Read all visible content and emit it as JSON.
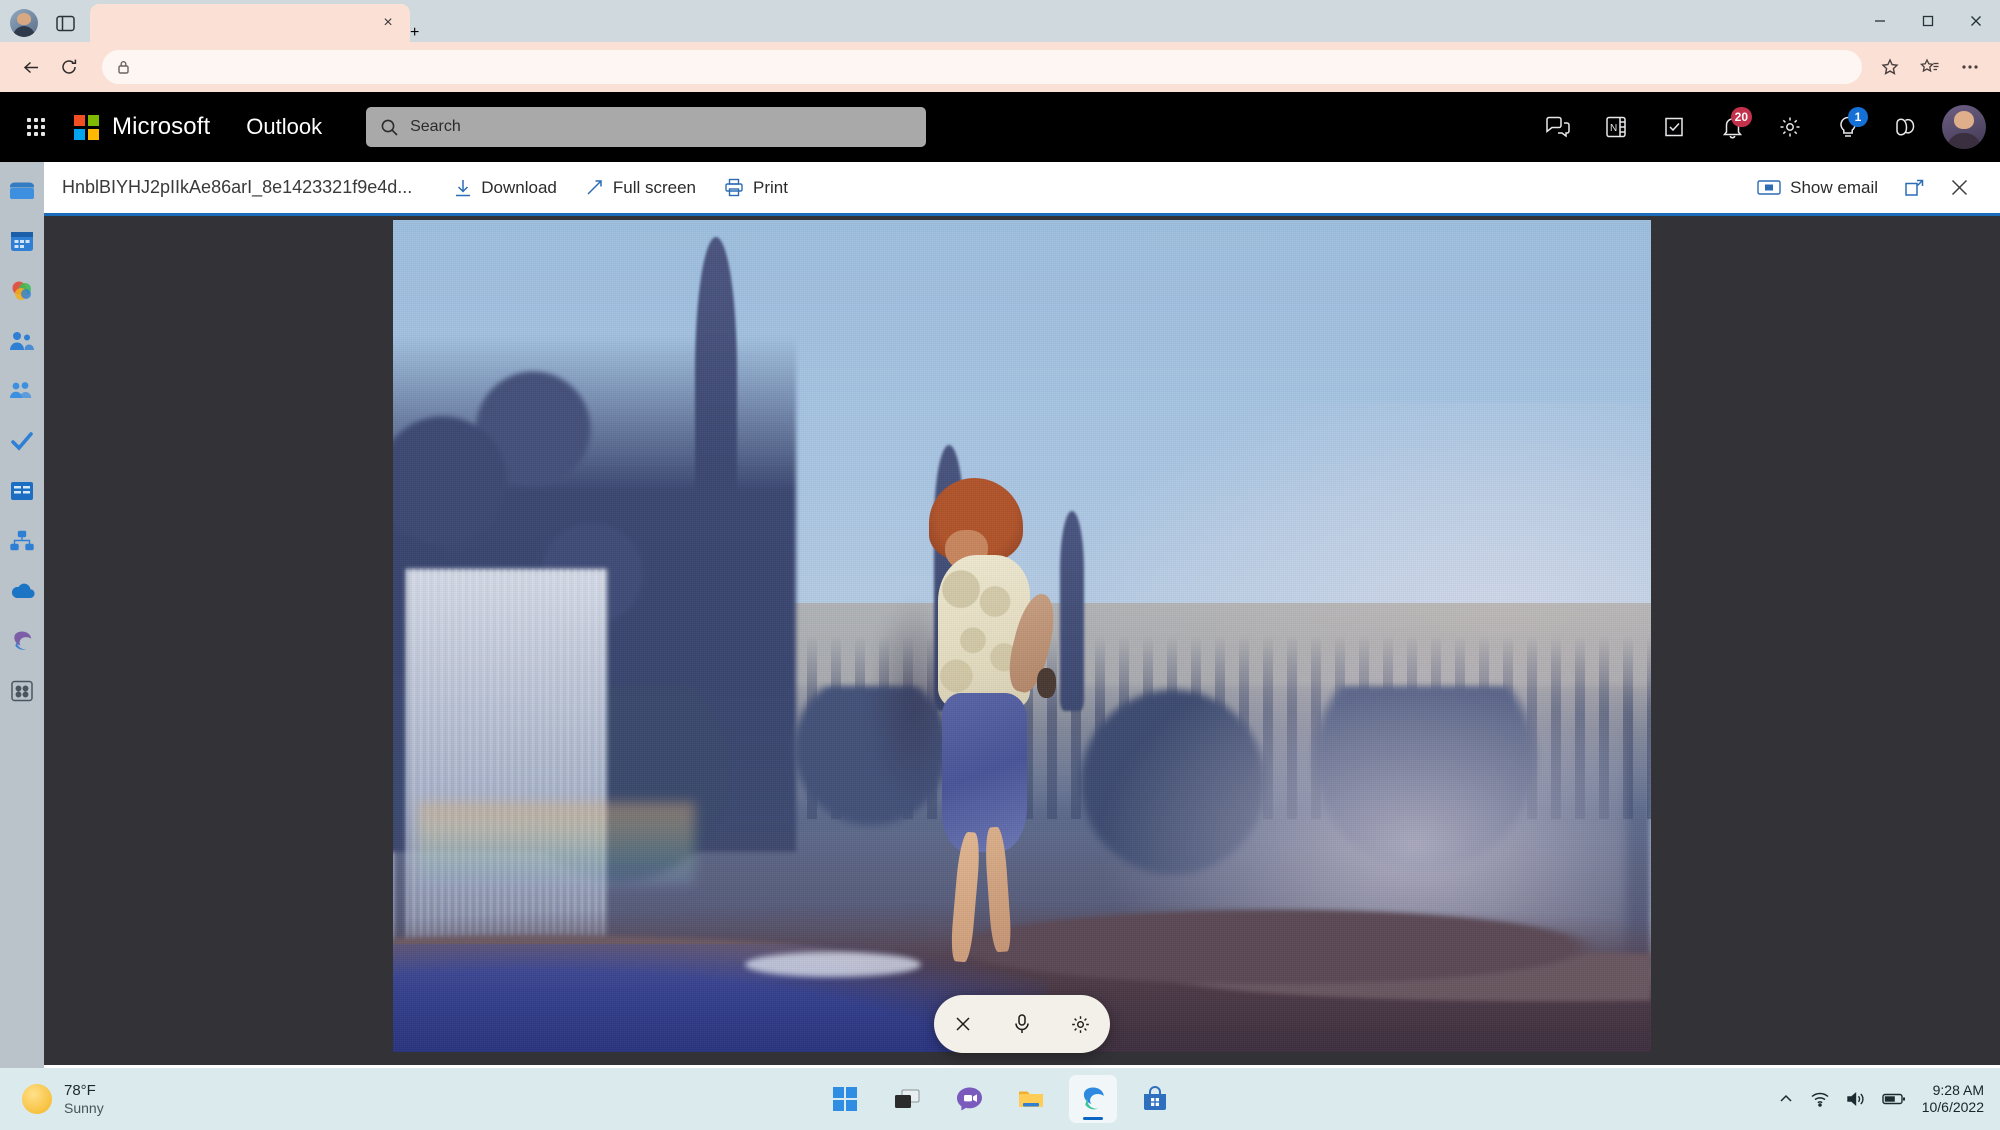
{
  "browser": {
    "tab": {
      "title": "",
      "close_label": "×"
    },
    "newtab_label": "+",
    "window_controls": {
      "minimize": "—",
      "maximize": "▢",
      "close": "✕"
    },
    "address": {
      "url": "",
      "placeholder": ""
    },
    "icons": {
      "profile": "profile-avatar-icon",
      "split_screen": "split-screen-icon",
      "back": "back-arrow-icon",
      "refresh": "refresh-icon",
      "lock": "lock-icon",
      "favorite": "star-icon",
      "favorites_list": "favorites-list-icon",
      "more": "ellipsis-icon"
    }
  },
  "outlook_header": {
    "waffle": "app-launcher-icon",
    "brand": "Microsoft",
    "app_name": "Outlook",
    "logo_colors": [
      "#f25022",
      "#7fba00",
      "#00a4ef",
      "#ffb900"
    ],
    "search": {
      "placeholder": "Search",
      "value": "",
      "icon": "search-icon"
    },
    "actions": [
      {
        "name": "teams-chat-icon",
        "label": "Teams chat",
        "badge": null
      },
      {
        "name": "onenote-icon",
        "label": "OneNote",
        "badge": null
      },
      {
        "name": "to-do-icon",
        "label": "To Do",
        "badge": null
      },
      {
        "name": "bell-icon",
        "label": "Notifications",
        "badge": "20",
        "badge_color": "#c4314b"
      },
      {
        "name": "gear-icon",
        "label": "Settings",
        "badge": null
      },
      {
        "name": "lightbulb-icon",
        "label": "Tips",
        "badge": "1",
        "badge_color": "#1470d4"
      },
      {
        "name": "copilot-icon",
        "label": "Copilot",
        "badge": null
      }
    ],
    "account_avatar": "account-avatar"
  },
  "app_rail": {
    "items": [
      {
        "name": "sidebar-item-mail",
        "label": "Mail"
      },
      {
        "name": "sidebar-item-calendar",
        "label": "Calendar"
      },
      {
        "name": "sidebar-item-office",
        "label": "Microsoft 365"
      },
      {
        "name": "sidebar-item-people",
        "label": "People"
      },
      {
        "name": "sidebar-item-groups",
        "label": "Groups"
      },
      {
        "name": "sidebar-item-todo",
        "label": "To Do"
      },
      {
        "name": "sidebar-item-word",
        "label": "Word"
      },
      {
        "name": "sidebar-item-visio",
        "label": "Visio"
      },
      {
        "name": "sidebar-item-onedrive",
        "label": "OneDrive"
      },
      {
        "name": "sidebar-item-edge",
        "label": "Edge"
      },
      {
        "name": "sidebar-item-more-apps",
        "label": "More apps"
      }
    ]
  },
  "attachment_viewer": {
    "filename": "HnblBIYHJ2pIIkAe86arI_8e1423321f9e4d...",
    "toolbar": {
      "download_label": "Download",
      "fullscreen_label": "Full screen",
      "print_label": "Print",
      "show_email_label": "Show email",
      "popout_label": "Open in new window",
      "close_label": "Close",
      "accent_color": "#1a6bb8"
    },
    "photo": {
      "alt": "Vintage color photograph of a woman with red hair in a cream patterned blouse and blue capri pants standing on dark rocks beside a river, with a large waterfall, mist, a faint rainbow and a forested cliff behind her under a blue sky.",
      "background_color": "#333237"
    }
  },
  "voice_access": {
    "buttons": [
      {
        "name": "close-icon",
        "label": "Close"
      },
      {
        "name": "microphone-icon",
        "label": "Microphone"
      },
      {
        "name": "gear-icon",
        "label": "Settings"
      }
    ]
  },
  "taskbar": {
    "weather": {
      "temperature": "78°F",
      "condition": "Sunny",
      "icon": "sun-icon"
    },
    "apps": [
      {
        "name": "taskbar-start-button",
        "label": "Start",
        "active": false
      },
      {
        "name": "taskbar-task-view",
        "label": "Task view",
        "active": false
      },
      {
        "name": "taskbar-chat",
        "label": "Chat",
        "active": false
      },
      {
        "name": "taskbar-file-explorer",
        "label": "File Explorer",
        "active": false
      },
      {
        "name": "taskbar-edge",
        "label": "Microsoft Edge",
        "active": true
      },
      {
        "name": "taskbar-store",
        "label": "Microsoft Store",
        "active": false
      }
    ],
    "tray": {
      "chevron": "show-hidden-icons",
      "wifi": "wifi-icon",
      "volume": "volume-icon",
      "battery": "battery-icon"
    },
    "clock": {
      "time": "9:28 AM",
      "date": "10/6/2022"
    }
  }
}
